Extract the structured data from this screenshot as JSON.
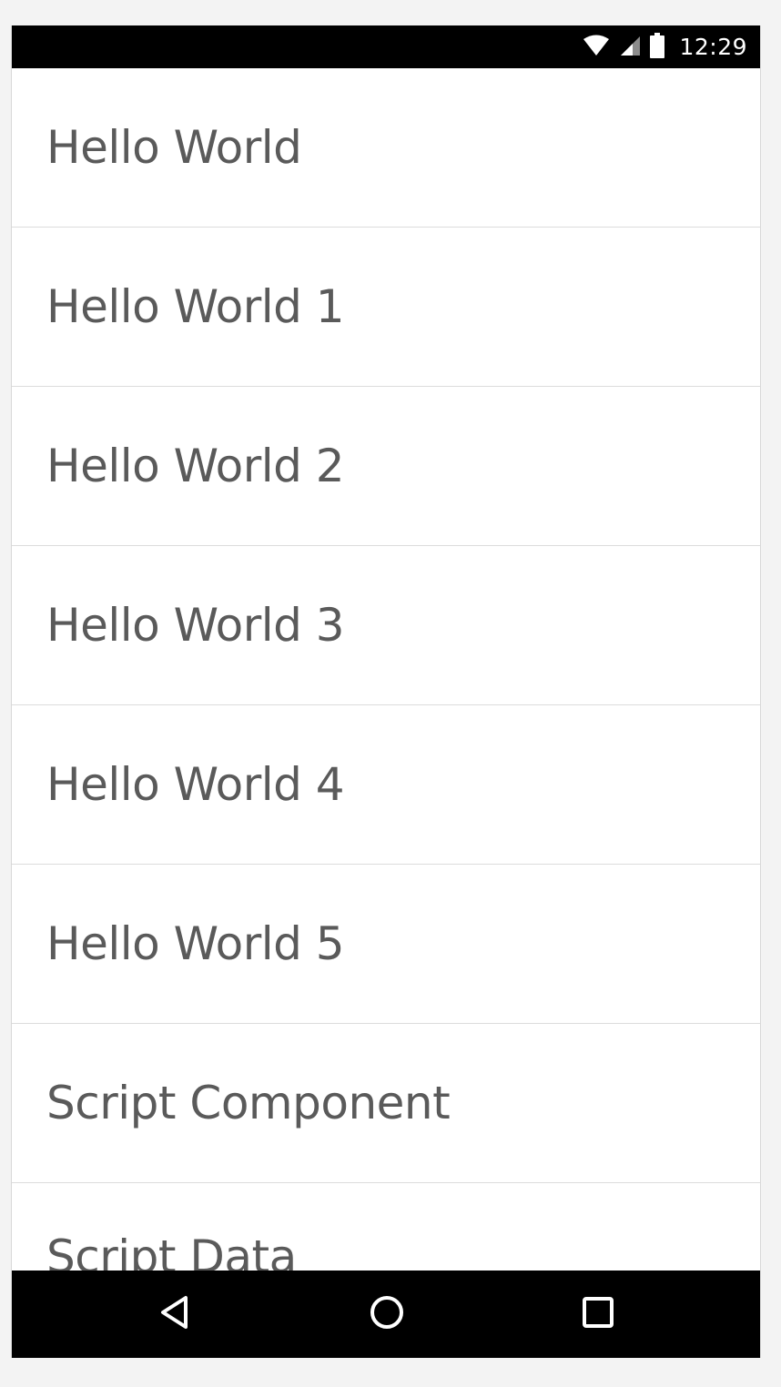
{
  "status_bar": {
    "time": "12:29",
    "icons": [
      "wifi-icon",
      "cell-signal-icon",
      "battery-icon"
    ]
  },
  "list": {
    "items": [
      {
        "label": "Hello World"
      },
      {
        "label": "Hello World 1"
      },
      {
        "label": "Hello World 2"
      },
      {
        "label": "Hello World 3"
      },
      {
        "label": "Hello World 4"
      },
      {
        "label": "Hello World 5"
      },
      {
        "label": "Script Component"
      },
      {
        "label": "Script Data"
      }
    ]
  },
  "nav_bar": {
    "icons": [
      "back-icon",
      "home-icon",
      "recent-apps-icon"
    ]
  },
  "colors": {
    "bar_background": "#000000",
    "list_text": "#5a5a5a",
    "divider": "#dcdcdc"
  }
}
